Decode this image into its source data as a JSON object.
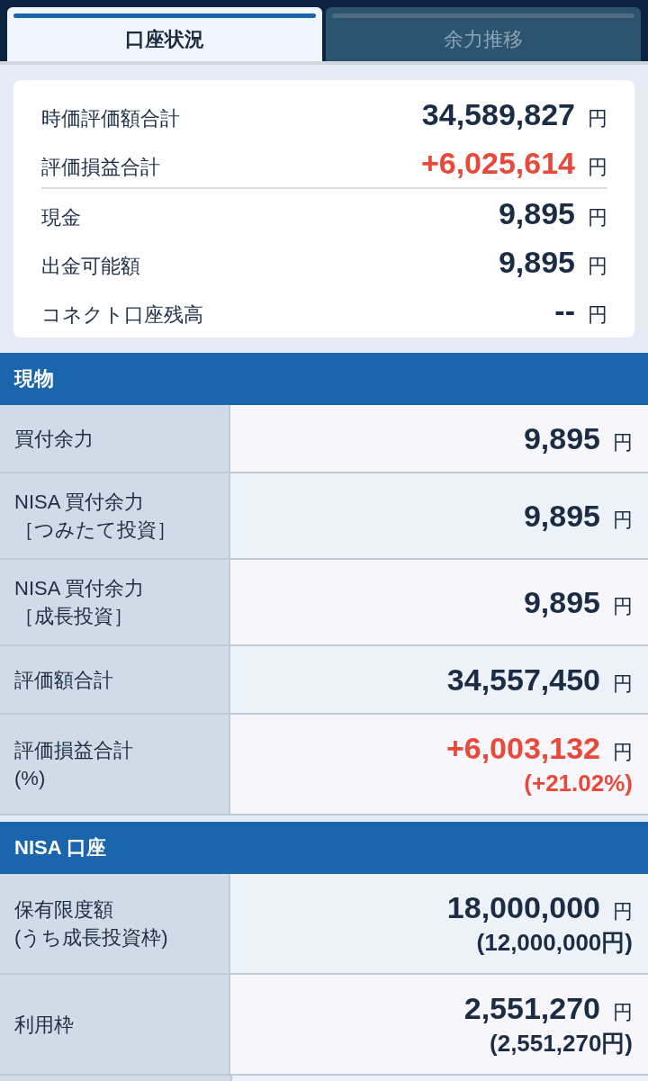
{
  "tabs": [
    {
      "label": "口座状況",
      "selected": true
    },
    {
      "label": "余力推移",
      "selected": false
    }
  ],
  "summary": {
    "groups": [
      [
        {
          "label": "時価評価額合計",
          "value": "34,589,827",
          "unit": "円",
          "color": "#1b2d45"
        },
        {
          "label": "評価損益合計",
          "value": "+6,025,614",
          "unit": "円",
          "color": "#e8493a"
        }
      ],
      [
        {
          "label": "現金",
          "value": "9,895",
          "unit": "円",
          "color": "#1b2d45"
        },
        {
          "label": "出金可能額",
          "value": "9,895",
          "unit": "円",
          "color": "#1b2d45"
        },
        {
          "label": "コネクト口座残高",
          "value": "--",
          "unit": "円",
          "color": "#1b2d45"
        }
      ]
    ]
  },
  "sections": [
    {
      "title": "現物",
      "rows": [
        {
          "label": "買付余力",
          "value": "9,895",
          "unit": "円",
          "color": "#1b2d45"
        },
        {
          "label": "NISA 買付余力",
          "sublabel": "［つみたて投資］",
          "value": "9,895",
          "unit": "円",
          "color": "#1b2d45"
        },
        {
          "label": "NISA 買付余力",
          "sublabel": "［成長投資］",
          "value": "9,895",
          "unit": "円",
          "color": "#1b2d45"
        },
        {
          "label": "評価額合計",
          "value": "34,557,450",
          "unit": "円",
          "color": "#1b2d45"
        },
        {
          "label": "評価損益合計",
          "sublabel": "(%)",
          "value": "+6,003,132",
          "unit": "円",
          "color": "#e8493a",
          "sub": "(+21.02%)"
        }
      ]
    },
    {
      "title": "NISA 口座",
      "rows": [
        {
          "label": "保有限度額",
          "sublabel": "(うち成長投資枠)",
          "value": "18,000,000",
          "unit": "円",
          "color": "#1b2d45",
          "sub": "(12,000,000円)"
        },
        {
          "label": "利用枠",
          "value": "2,551,270",
          "unit": "円",
          "color": "#1b2d45",
          "sub": "(2,551,270円)"
        }
      ]
    }
  ]
}
